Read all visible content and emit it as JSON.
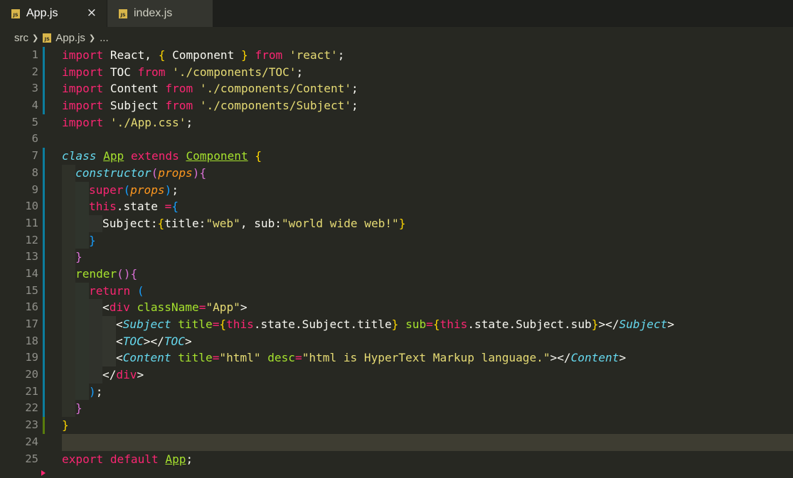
{
  "tabs": [
    {
      "label": "App.js",
      "icon": "js-file-icon",
      "close_glyph": "×"
    },
    {
      "label": "index.js",
      "icon": "js-file-icon"
    }
  ],
  "icon_text": "JS",
  "breadcrumb": {
    "folder": "src",
    "file": "App.js",
    "more": "..."
  },
  "colors": {
    "background": "#272822",
    "keyword": "#f92672",
    "string": "#e6db74",
    "class_name": "#a6e22e",
    "storage": "#66d9ef",
    "parameter": "#fd971f",
    "modified_gutter": "#0c7d9d",
    "added_gutter": "#587c0c"
  },
  "line_numbers": [
    "1",
    "2",
    "3",
    "4",
    "5",
    "6",
    "7",
    "8",
    "9",
    "10",
    "11",
    "12",
    "13",
    "14",
    "15",
    "16",
    "17",
    "18",
    "19",
    "20",
    "21",
    "22",
    "23",
    "24",
    "25"
  ],
  "code": {
    "l1": {
      "import": "import",
      "react_name": "React",
      "comma": ",",
      "lbrace": "{",
      "component": "Component",
      "rbrace": "}",
      "from": "from",
      "source": "'react'",
      "semi": ";"
    },
    "l2": {
      "import": "import",
      "name": "TOC",
      "from": "from",
      "source": "'./components/TOC'",
      "semi": ";"
    },
    "l3": {
      "import": "import",
      "name": "Content",
      "from": "from",
      "source": "'./components/Content'",
      "semi": ";"
    },
    "l4": {
      "import": "import",
      "name": "Subject",
      "from": "from",
      "source": "'./components/Subject'",
      "semi": ";"
    },
    "l5": {
      "import": "import",
      "source": "'./App.css'",
      "semi": ";"
    },
    "l7": {
      "class": "class",
      "name": "App",
      "extends": "extends",
      "parent": "Component",
      "lbrace": "{"
    },
    "l8": {
      "method": "constructor",
      "lparen": "(",
      "param": "props",
      "rparen": ")",
      "lbrace": "{"
    },
    "l9": {
      "super": "super",
      "lparen": "(",
      "arg": "props",
      "rparen": ")",
      "semi": ";"
    },
    "l10": {
      "this": "this",
      "prop": ".state",
      "eq": "=",
      "lbrace": "{"
    },
    "l11": {
      "key": "Subject:",
      "lbrace": "{",
      "k1": "title:",
      "v1": "\"web\"",
      "comma": ",",
      "k2": "sub:",
      "v2": "\"world wide web!\"",
      "rbrace": "}"
    },
    "l12": {
      "rbrace": "}"
    },
    "l13": {
      "rbrace": "}"
    },
    "l14": {
      "method": "render",
      "lparen": "(",
      "rparen": ")",
      "lbrace": "{"
    },
    "l15": {
      "return": "return",
      "lparen": "("
    },
    "l16": {
      "lt": "<",
      "tag": "div",
      "attr": "className",
      "eq": "=",
      "value": "\"App\"",
      "gt": ">"
    },
    "l17": {
      "lt": "<",
      "tag": "Subject",
      "attr1": "title",
      "eq1": "=",
      "lb1": "{",
      "this1": "this",
      "expr1": ".state.Subject.title",
      "rb1": "}",
      "attr2": "sub",
      "eq2": "=",
      "lb2": "{",
      "this2": "this",
      "expr2": ".state.Subject.sub",
      "rb2": "}",
      "mid": "></",
      "close_tag": "Subject",
      "gt": ">"
    },
    "l18": {
      "lt": "<",
      "tag": "TOC",
      "mid": "></",
      "close_tag": "TOC",
      "gt": ">"
    },
    "l19": {
      "lt": "<",
      "tag": "Content",
      "attr1": "title",
      "eq1": "=",
      "v1": "\"html\"",
      "attr2": "desc",
      "eq2": "=",
      "v2": "\"html is HyperText Markup language.\"",
      "mid": "></",
      "close_tag": "Content",
      "gt": ">"
    },
    "l20": {
      "lt": "</",
      "tag": "div",
      "gt": ">"
    },
    "l21": {
      "rparen": ")",
      "semi": ";"
    },
    "l22": {
      "rbrace": "}"
    },
    "l23": {
      "rbrace": "}"
    },
    "l25": {
      "export": "export",
      "default": "default",
      "name": "App",
      "semi": ";"
    }
  }
}
